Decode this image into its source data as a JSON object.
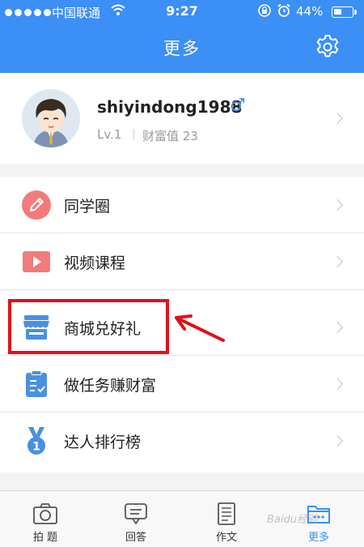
{
  "status_bar": {
    "carrier": "中国联通",
    "time": "9:27",
    "battery": "44%",
    "battery_level": 0.44
  },
  "header": {
    "title": "更多"
  },
  "profile": {
    "username": "shiyindong1988",
    "gender_symbol": "♂",
    "level": "Lv.1",
    "wealth": "财富值 23"
  },
  "menu": {
    "items": [
      {
        "label": "同学圈",
        "icon": "pencil-icon"
      },
      {
        "label": "视频课程",
        "icon": "video-play-icon"
      },
      {
        "label": "商城兑好礼",
        "icon": "store-icon"
      },
      {
        "label": "做任务赚财富",
        "icon": "task-clipboard-icon"
      },
      {
        "label": "达人排行榜",
        "icon": "medal-icon"
      }
    ]
  },
  "tabbar": {
    "tabs": [
      {
        "label": "拍 题",
        "icon": "camera-icon"
      },
      {
        "label": "回答",
        "icon": "answer-bubble-icon"
      },
      {
        "label": "作文",
        "icon": "document-icon"
      },
      {
        "label": "更多",
        "icon": "more-folder-icon",
        "active": true
      }
    ]
  },
  "colors": {
    "brand": "#3b8ff5",
    "highlight": "#e0101b"
  },
  "watermark": "Baidu经验"
}
